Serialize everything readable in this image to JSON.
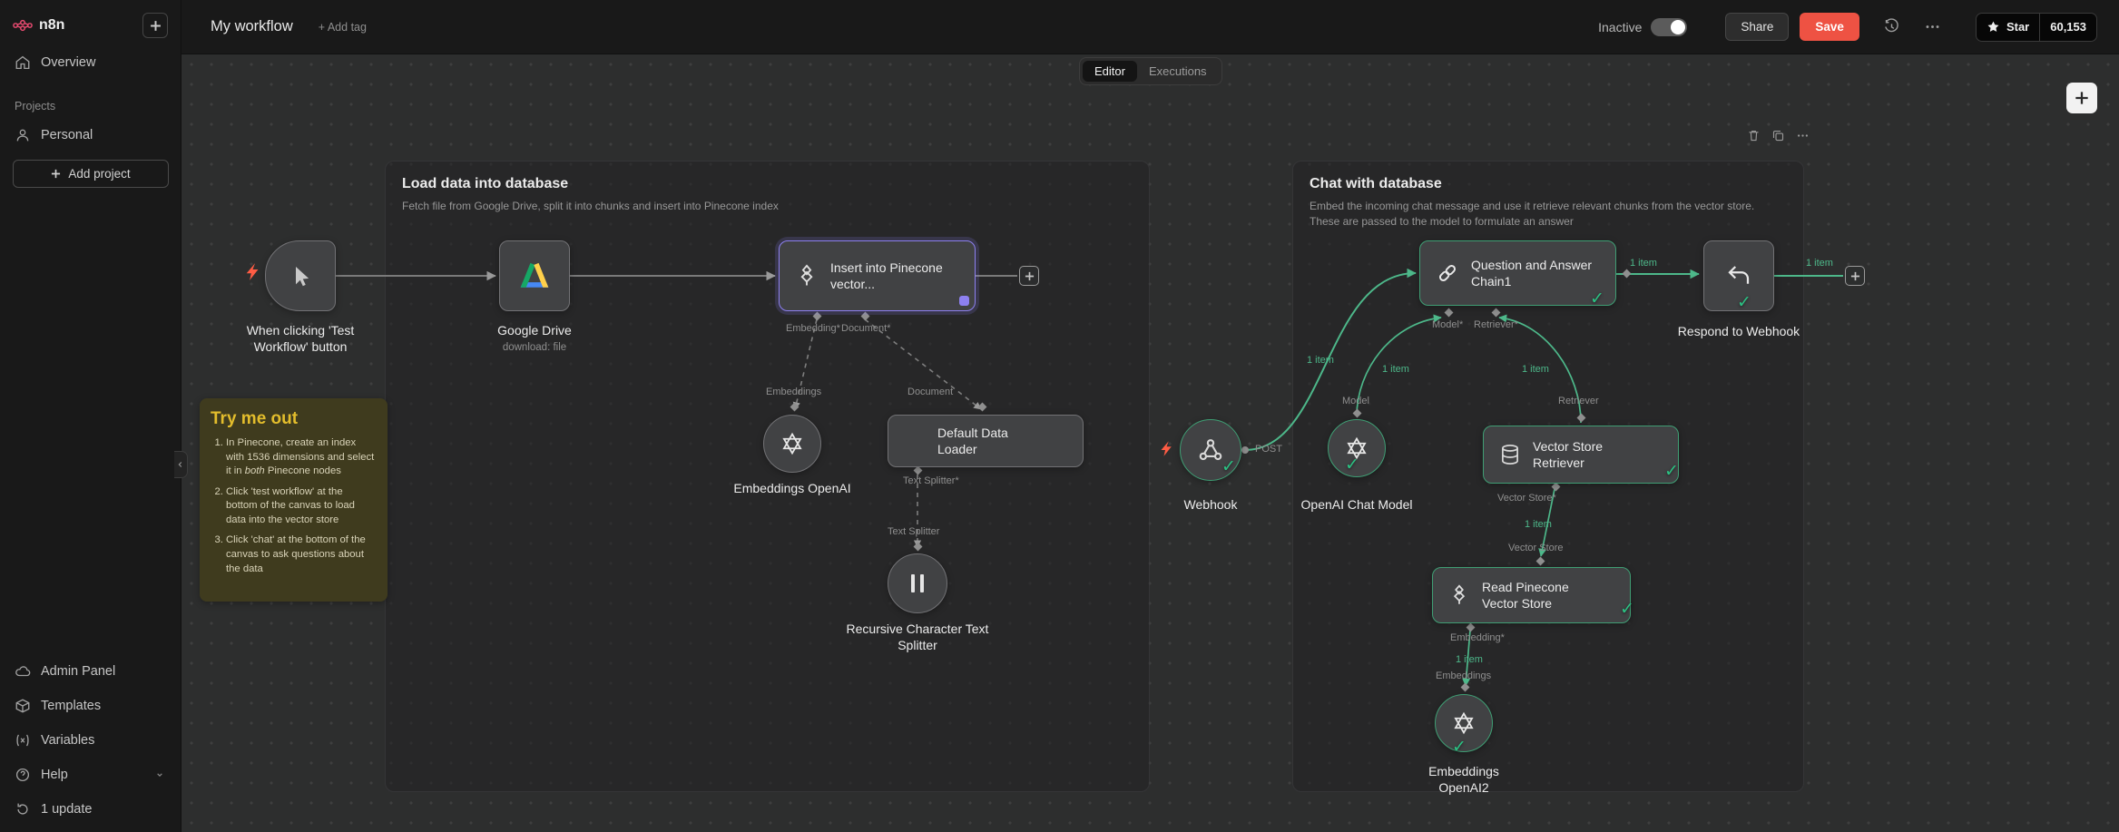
{
  "app": {
    "brand": "n8n"
  },
  "colors": {
    "accent": "#ea4b71",
    "save_button": "#ee5243",
    "success": "#2bc283",
    "selected_node": "#8d80f0",
    "sticky_title": "#e3bd2c"
  },
  "sidebar": {
    "overview": "Overview",
    "projects_header": "Projects",
    "personal": "Personal",
    "add_project": "Add project",
    "admin_panel": "Admin Panel",
    "templates": "Templates",
    "variables": "Variables",
    "help": "Help",
    "update": "1 update"
  },
  "topbar": {
    "title": "My workflow",
    "add_tag": "+ Add tag",
    "status": "Inactive",
    "share": "Share",
    "save": "Save",
    "github_star": "Star",
    "github_count": "60,153"
  },
  "tabs": {
    "editor": "Editor",
    "executions": "Executions"
  },
  "groups": {
    "load": {
      "title": "Load data into database",
      "subtitle": "Fetch file from Google Drive, split it into chunks and insert into Pinecone index"
    },
    "chat": {
      "title": "Chat with database",
      "subtitle": "Embed the incoming chat message and use it retrieve relevant chunks from the vector store. These are passed to the model to formulate an answer"
    }
  },
  "sticky": {
    "title": "Try me out",
    "step1_a": "In Pinecone, create an index with 1536 dimensions and select it in ",
    "step1_em": "both",
    "step1_b": " Pinecone nodes",
    "step2": "Click 'test workflow' at the bottom of the canvas to load data into the vector store",
    "step3": "Click 'chat' at the bottom of the canvas to ask questions about the data"
  },
  "nodes": {
    "trigger": {
      "label": "When clicking 'Test Workflow' button"
    },
    "gdrive": {
      "label": "Google Drive",
      "sublabel": "download: file"
    },
    "pinecone_insert": {
      "label": "Insert into Pinecone vector..."
    },
    "embeddings1": {
      "label": "Embeddings OpenAI"
    },
    "data_loader": {
      "label": "Default Data Loader"
    },
    "splitter": {
      "label": "Recursive Character Text Splitter"
    },
    "webhook": {
      "label": "Webhook",
      "method": "POST"
    },
    "chat_model": {
      "label": "OpenAI Chat Model"
    },
    "retriever": {
      "label": "Vector Store Retriever"
    },
    "qa_chain": {
      "label": "Question and Answer Chain1"
    },
    "respond": {
      "label": "Respond to Webhook"
    },
    "read_pinecone": {
      "label": "Read Pinecone Vector Store"
    },
    "embeddings2": {
      "label": "Embeddings OpenAI2"
    }
  },
  "conn": {
    "embedding_req": "Embedding*",
    "document_req": "Document*",
    "embeddings": "Embeddings",
    "document": "Document",
    "text_splitter_req": "Text Splitter*",
    "text_splitter": "Text Splitter",
    "model_req": "Model*",
    "retriever_req": "Retriever*",
    "model": "Model",
    "retriever": "Retriever",
    "vector_store_req": "Vector Store*",
    "vector_store": "Vector Store",
    "one_item": "1 item"
  }
}
